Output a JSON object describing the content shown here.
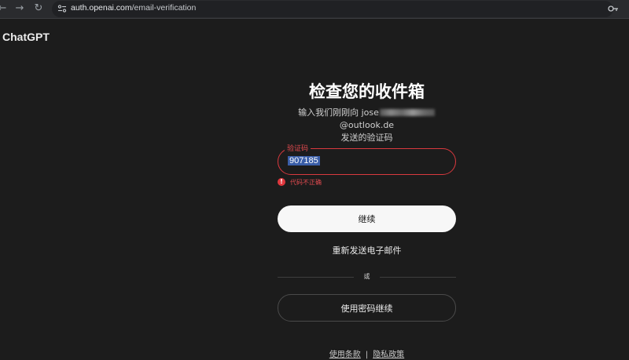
{
  "browser": {
    "url_host": "auth.openai.com",
    "url_path": "/email-verification",
    "back_icon": "arrow-left-icon",
    "forward_icon": "arrow-right-icon",
    "reload_icon": "reload-icon",
    "key_icon": "key-icon"
  },
  "brand": {
    "name": "ChatGPT"
  },
  "verify": {
    "title": "检查您的收件箱",
    "subtitle_prefix": "输入我们刚刚向 jose",
    "subtitle_suffix": "@outlook.de",
    "subtitle_line2": "发送的验证码",
    "code_label": "验证码",
    "code_value": "907185",
    "error_text": "代码不正确",
    "continue_label": "继续",
    "resend_label": "重新发送电子邮件",
    "or_label": "或",
    "password_label": "使用密码继续"
  },
  "footer": {
    "terms": "使用条款",
    "separator": "|",
    "privacy": "隐私政策"
  },
  "colors": {
    "background": "#1c1c1c",
    "error": "#e04a4f",
    "selection": "#3a5ea8",
    "button_primary": "#f7f7f7"
  }
}
